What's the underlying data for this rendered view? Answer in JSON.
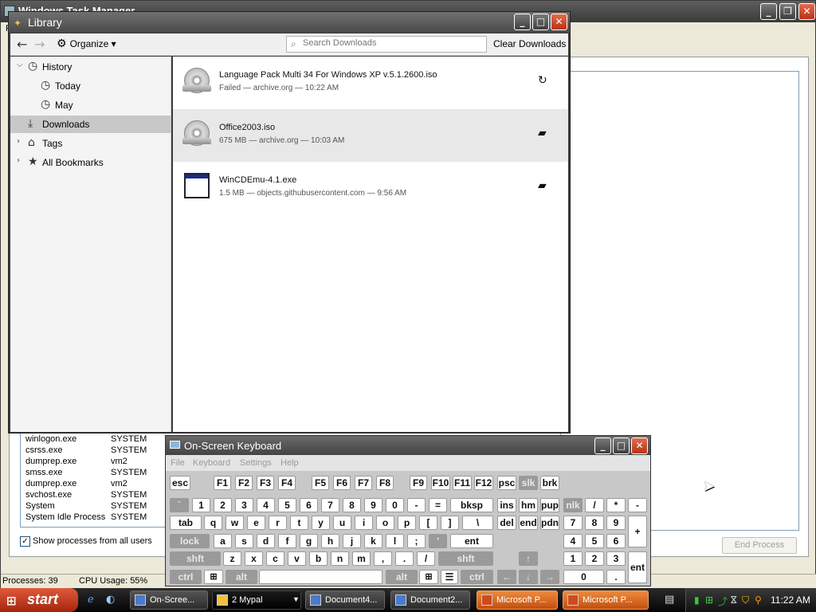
{
  "taskmgr": {
    "title": "Windows Task Manager",
    "menu_file": "F",
    "processes": [
      {
        "name": "winlogon.exe",
        "user": "SYSTEM"
      },
      {
        "name": "csrss.exe",
        "user": "SYSTEM"
      },
      {
        "name": "dumprep.exe",
        "user": "vm2"
      },
      {
        "name": "smss.exe",
        "user": "SYSTEM"
      },
      {
        "name": "dumprep.exe",
        "user": "vm2"
      },
      {
        "name": "svchost.exe",
        "user": "SYSTEM"
      },
      {
        "name": "System",
        "user": "SYSTEM"
      },
      {
        "name": "System Idle Process",
        "user": "SYSTEM"
      }
    ],
    "show_all_label": "Show processes from all users",
    "show_all_checked": "✓",
    "end_process_label": "End Process",
    "status_processes": "Processes: 39",
    "status_cpu": "CPU Usage: 55%",
    "titlebar_buttons": {
      "min": "_",
      "max": "❐",
      "close": "✕"
    }
  },
  "library": {
    "title": "Library",
    "toolbar": {
      "back": "←",
      "forward": "→",
      "organize_label": "Organize",
      "organize_arrow": "▾",
      "search_placeholder": "Search Downloads",
      "clear_label": "Clear Downloads"
    },
    "sidebar": {
      "history": "History",
      "today": "Today",
      "may": "May",
      "downloads": "Downloads",
      "tags": "Tags",
      "all_bookmarks": "All Bookmarks"
    },
    "downloads": [
      {
        "name": "Language Pack Multi 34 For Windows XP v.5.1.2600.iso",
        "meta": "Failed — archive.org — 10:22 AM",
        "action_icon": "retry-icon"
      },
      {
        "name": "Office2003.iso",
        "meta": "675 MB — archive.org — 10:03 AM",
        "action_icon": "folder-icon"
      },
      {
        "name": "WinCDEmu-4.1.exe",
        "meta": "1.5 MB — objects.githubusercontent.com — 9:56 AM",
        "action_icon": "folder-icon"
      }
    ]
  },
  "osk": {
    "title": "On-Screen Keyboard",
    "menu": {
      "file": "File",
      "keyboard": "Keyboard",
      "settings": "Settings",
      "help": "Help"
    },
    "keys": {
      "esc": "esc",
      "f1": "F1",
      "f2": "F2",
      "f3": "F3",
      "f4": "F4",
      "f5": "F5",
      "f6": "F6",
      "f7": "F7",
      "f8": "F8",
      "f9": "F9",
      "f10": "F10",
      "f11": "F11",
      "f12": "F12",
      "psc": "psc",
      "slk": "slk",
      "brk": "brk",
      "grave": "`",
      "n1": "1",
      "n2": "2",
      "n3": "3",
      "n4": "4",
      "n5": "5",
      "n6": "6",
      "n7": "7",
      "n8": "8",
      "n9": "9",
      "n0": "0",
      "minus": "-",
      "equals": "=",
      "bksp": "bksp",
      "ins": "ins",
      "hm": "hm",
      "pup": "pup",
      "nlk": "nlk",
      "kp_div": "/",
      "kp_mul": "*",
      "kp_sub": "-",
      "tab": "tab",
      "q": "q",
      "w": "w",
      "e": "e",
      "r": "r",
      "t": "t",
      "y": "y",
      "u": "u",
      "i": "i",
      "o": "o",
      "p": "p",
      "lbracket": "[",
      "rbracket": "]",
      "backslash": "\\",
      "del": "del",
      "end": "end",
      "pdn": "pdn",
      "kp7": "7",
      "kp8": "8",
      "kp9": "9",
      "kp_add": "+",
      "lock": "lock",
      "a": "a",
      "s": "s",
      "d": "d",
      "f": "f",
      "g": "g",
      "h": "h",
      "j": "j",
      "k": "k",
      "l": "l",
      "semicolon": ";",
      "quote": "'",
      "ent": "ent",
      "kp4": "4",
      "kp5": "5",
      "kp6": "6",
      "shft": "shft",
      "z": "z",
      "x": "x",
      "c": "c",
      "v": "v",
      "b": "b",
      "n": "n",
      "m": "m",
      "comma": ",",
      "period": ".",
      "slash": "/",
      "rshft": "shft",
      "up": "↑",
      "kp1": "1",
      "kp2": "2",
      "kp3": "3",
      "kp_ent": "ent",
      "ctrl": "ctrl",
      "alt": "alt",
      "ralt": "alt",
      "rctrl": "ctrl",
      "left": "←",
      "down": "↓",
      "right": "→",
      "kp0": "0",
      "kp_dot": "."
    }
  },
  "taskbar": {
    "start_label": "start",
    "tasks": [
      {
        "label": "On-Scree..."
      },
      {
        "label": "2 Mypal"
      },
      {
        "label": "Document4..."
      },
      {
        "label": "Document2..."
      },
      {
        "label": "Microsoft P..."
      },
      {
        "label": "Microsoft P..."
      }
    ],
    "clock": "11:22 AM"
  },
  "colors": {
    "accent_orange": "#e05a3a",
    "selection_gray": "#c8c8c8"
  }
}
